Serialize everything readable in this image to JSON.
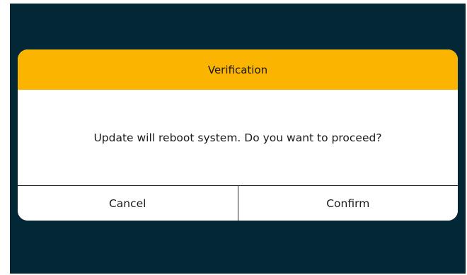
{
  "dialog": {
    "title": "Verification",
    "message": "Update will reboot system. Do you want to proceed?",
    "cancel_label": "Cancel",
    "confirm_label": "Confirm"
  },
  "colors": {
    "background": "#032734",
    "header": "#fbb400",
    "dialog": "#ffffff",
    "text": "#1a1a1a"
  }
}
